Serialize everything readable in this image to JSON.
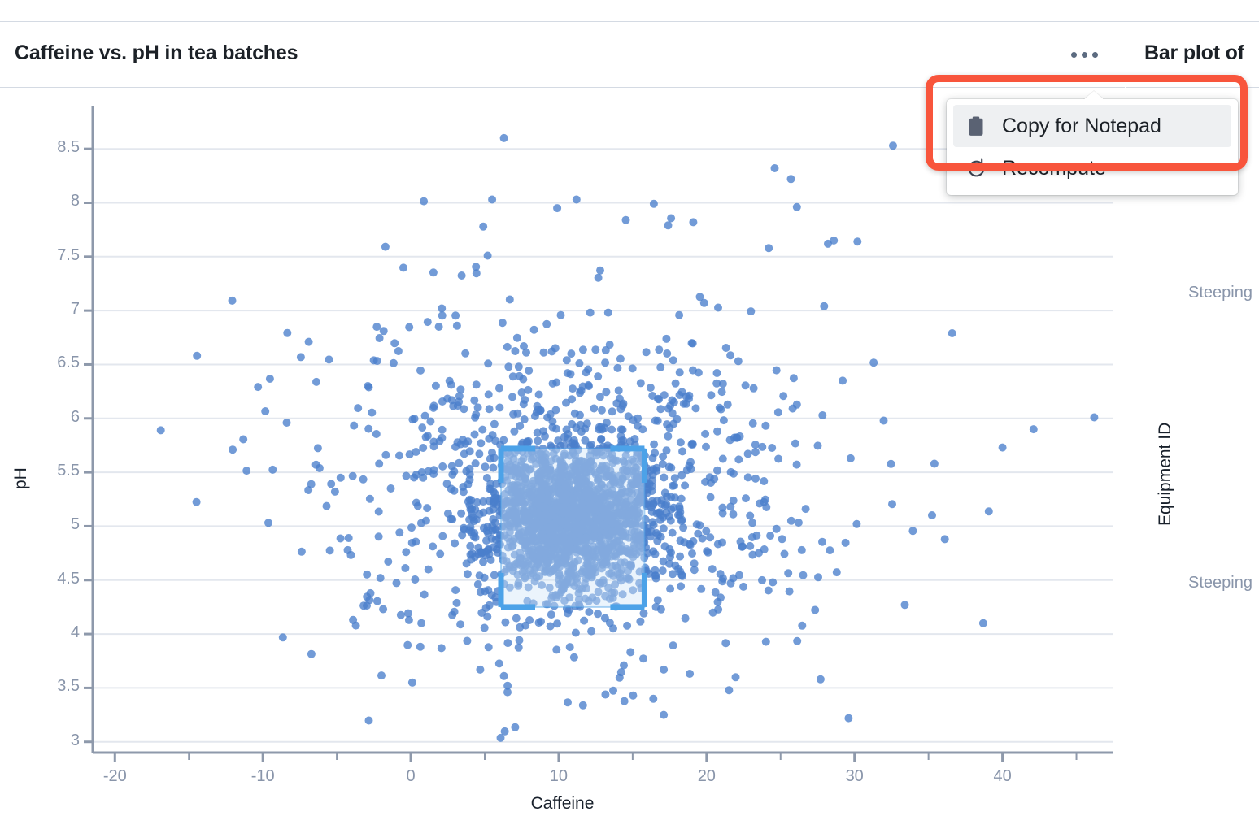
{
  "left_panel": {
    "title": "Caffeine vs. pH in tea batches",
    "menu_button_icon": "ellipsis-icon"
  },
  "right_panel": {
    "title": "Bar plot of",
    "y_axis_label": "Equipment ID",
    "tick_labels": [
      "Steeping",
      "Steeping"
    ]
  },
  "menu": {
    "items": [
      {
        "label": "Copy for Notepad",
        "icon": "clipboard-icon",
        "active": true
      },
      {
        "label": "Recompute",
        "icon": "refresh-icon",
        "active": false
      }
    ]
  },
  "colors": {
    "point": "#4a7fcc",
    "gridline": "#e3e7ee",
    "axis": "#8e99ab",
    "tick_text": "#8995aa",
    "title_text": "#1c2127",
    "highlight": "#f8553c",
    "selection_fill": "#cfe5f7",
    "selection_handle": "#4ca2e8",
    "menu_hover": "#eef0f2"
  },
  "selection": {
    "x_range": [
      6.1,
      15.8
    ],
    "y_range": [
      4.25,
      5.72
    ],
    "label": "brush-selection-region"
  },
  "chart_data": {
    "type": "scatter",
    "title": "Caffeine vs. pH in tea batches",
    "xlabel": "Caffeine",
    "ylabel": "pH",
    "xlim": [
      -21.5,
      47.5
    ],
    "ylim": [
      2.9,
      8.75
    ],
    "xticks": [
      -20,
      -10,
      0,
      10,
      20,
      30,
      40
    ],
    "yticks": [
      3,
      3.5,
      4,
      4.5,
      5,
      5.5,
      6,
      6.5,
      7,
      7.5,
      8,
      8.5
    ],
    "grid": "horizontal",
    "legend": "none",
    "n_points": 2400,
    "cluster": {
      "x_center": 11.0,
      "y_center": 5.08,
      "x_sigma": 3.0,
      "y_sigma": 0.34,
      "fraction": 0.66
    },
    "halo": {
      "x_center": 11.0,
      "y_center": 5.35,
      "x_sigma": 8.6,
      "y_sigma": 0.85,
      "fraction": 0.34
    },
    "point_radius_px": 5,
    "point_opacity": 0.78,
    "outliers": [
      [
        6.3,
        8.6
      ],
      [
        32.6,
        8.53
      ],
      [
        24.6,
        8.32
      ],
      [
        25.7,
        8.22
      ],
      [
        5.5,
        8.03
      ],
      [
        11.2,
        8.03
      ],
      [
        26.1,
        7.96
      ],
      [
        9.9,
        7.95
      ],
      [
        4.9,
        7.78
      ],
      [
        17.4,
        7.79
      ],
      [
        19.1,
        7.82
      ],
      [
        28.2,
        7.62
      ],
      [
        28.6,
        7.65
      ],
      [
        30.2,
        7.64
      ],
      [
        24.2,
        7.58
      ],
      [
        5.2,
        7.51
      ],
      [
        2.1,
        7.02
      ],
      [
        -6.9,
        6.71
      ],
      [
        36.6,
        6.79
      ],
      [
        1.9,
        6.85
      ],
      [
        42.1,
        5.9
      ],
      [
        -16.9,
        5.89
      ],
      [
        46.2,
        6.01
      ],
      [
        -6.4,
        5.57
      ],
      [
        -4.2,
        4.89
      ],
      [
        -3.9,
        4.13
      ],
      [
        0.1,
        3.55
      ],
      [
        6.3,
        3.61
      ],
      [
        16.4,
        3.4
      ],
      [
        17.1,
        3.25
      ],
      [
        27.7,
        3.58
      ],
      [
        38.7,
        4.1
      ],
      [
        36.1,
        4.88
      ],
      [
        33.4,
        4.27
      ],
      [
        40.0,
        5.73
      ],
      [
        35.4,
        5.58
      ]
    ]
  }
}
